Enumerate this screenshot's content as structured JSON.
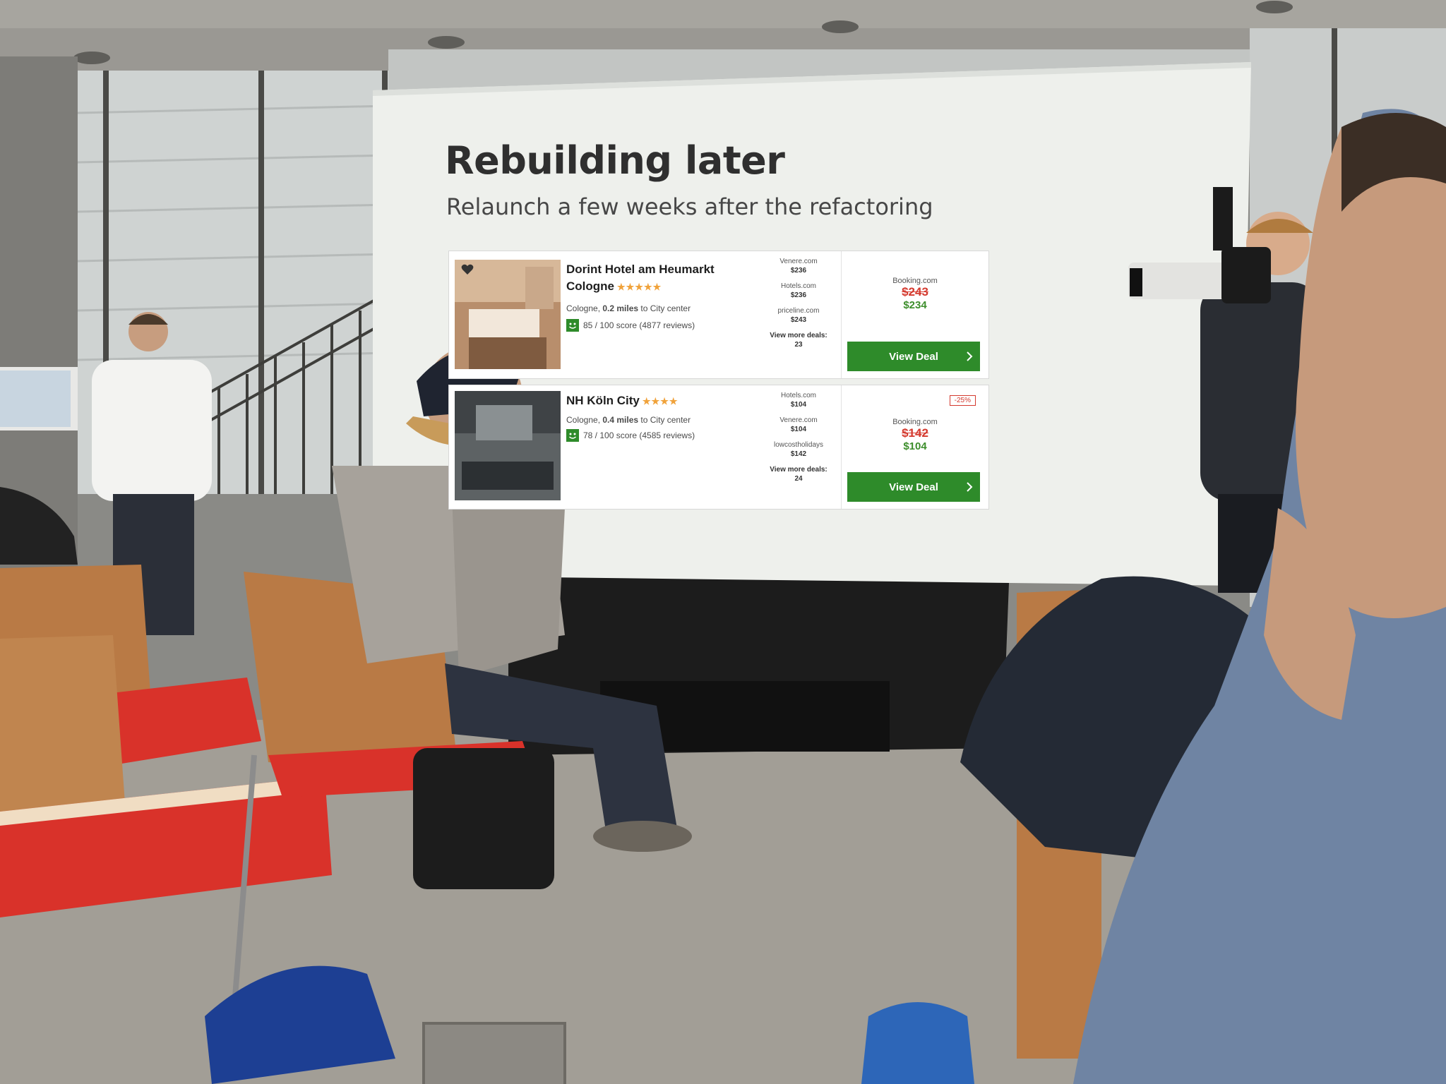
{
  "slide": {
    "title": "Rebuilding later",
    "subtitle": "Relaunch a few weeks after the refactoring",
    "listings": [
      {
        "hotel_name": "Dorint Hotel am Heumarkt",
        "city": "Cologne",
        "stars": "★★★★★",
        "distance_city": "Cologne, ",
        "distance_value": "0.2 miles",
        "distance_suffix": " to City center",
        "score": "85 / 100 score (4877 reviews)",
        "offers": [
          {
            "site": "Venere.com",
            "price": "$236"
          },
          {
            "site": "Hotels.com",
            "price": "$236"
          },
          {
            "site": "priceline.com",
            "price": "$243"
          }
        ],
        "more_deals_label": "View more deals:",
        "more_deals_count": "23",
        "best_site": "Booking.com",
        "old_price": "$243",
        "new_price": "$234",
        "discount": "",
        "button_label": "View Deal"
      },
      {
        "hotel_name": "NH Köln City",
        "city": "",
        "stars": "★★★★",
        "distance_city": "Cologne, ",
        "distance_value": "0.4 miles",
        "distance_suffix": " to City center",
        "score": "78 / 100 score (4585 reviews)",
        "offers": [
          {
            "site": "Hotels.com",
            "price": "$104"
          },
          {
            "site": "Venere.com",
            "price": "$104"
          },
          {
            "site": "lowcostholidays",
            "price": "$142"
          }
        ],
        "more_deals_label": "View more deals:",
        "more_deals_count": "24",
        "best_site": "Booking.com",
        "old_price": "$142",
        "new_price": "$104",
        "discount": "-25%",
        "button_label": "View Deal"
      }
    ]
  },
  "colors": {
    "screen": "#eef0ec",
    "deal_button": "#2e8b2a",
    "old_price": "#d43a2f",
    "new_price": "#3d8e2c",
    "stars": "#f0a23a",
    "chair_seat": "#d9322a",
    "chair_wood": "#b97a45"
  }
}
